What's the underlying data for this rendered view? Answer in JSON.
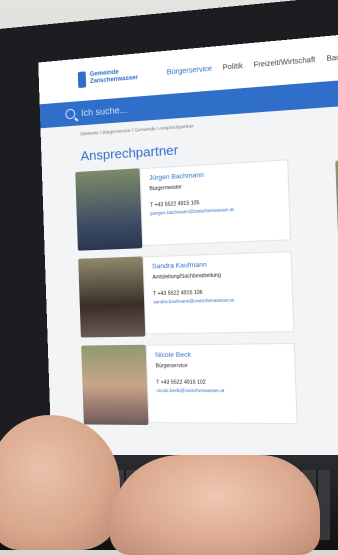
{
  "logo": {
    "text": "Gemeinde\nZwischenwasser"
  },
  "nav": [
    "Bürgerservice",
    "Politik",
    "Freizeit/Wirtschaft",
    "Baukultu"
  ],
  "search": {
    "placeholder": "Ich suche..."
  },
  "breadcrumb": "Startseite / Bürgerservice / Gemeinde / Ansprechpartner",
  "page_title": "Ansprechpartner",
  "contacts": [
    {
      "name": "Jürgen Bachmann",
      "role": "Bürgermeister",
      "phone": "T +43 5522 4915 105",
      "email": "juergen.bachmann@zwischenwasser.at"
    },
    {
      "name": "Sandra Kaufmann",
      "role": "Amtsleitung/Sachbearbeitung",
      "phone": "T +43 5522 4915 106",
      "email": "sandra.kaufmann@zwischenwasser.at"
    },
    {
      "name": "Nicole Beck",
      "role": "Bürgerservice",
      "phone": "T +43 5522 4915 102",
      "email": "nicole.beck@zwischenwasser.at"
    }
  ],
  "colors": {
    "accent": "#2f6fc9",
    "page_bg": "#f3f4f6",
    "bezel": "#1c1d20"
  }
}
